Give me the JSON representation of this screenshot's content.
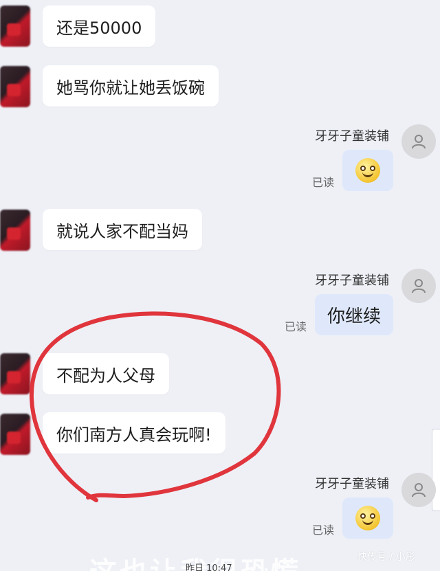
{
  "messages": [
    {
      "side": "left",
      "text": "还是50000"
    },
    {
      "side": "left",
      "text": "她骂你就让她丢饭碗"
    },
    {
      "side": "right",
      "sender": "牙牙子童装铺",
      "read": "已读",
      "emoji": "smile-emoji"
    },
    {
      "side": "left",
      "text": "就说人家不配当妈"
    },
    {
      "side": "right",
      "sender": "牙牙子童装铺",
      "read": "已读",
      "text": "你继续"
    },
    {
      "side": "left",
      "text": "不配为人父母"
    },
    {
      "side": "left",
      "text": "你们南方人真会玩啊!"
    },
    {
      "side": "right",
      "sender": "牙牙子童装铺",
      "read": "已读",
      "emoji": "smile-emoji"
    }
  ],
  "annotation": {
    "color": "#e0353c"
  },
  "watermark": "快传号 / 小彤",
  "bottom_overlay": "这也让我很恐慌",
  "bottom_partial": "昨日 10:47"
}
